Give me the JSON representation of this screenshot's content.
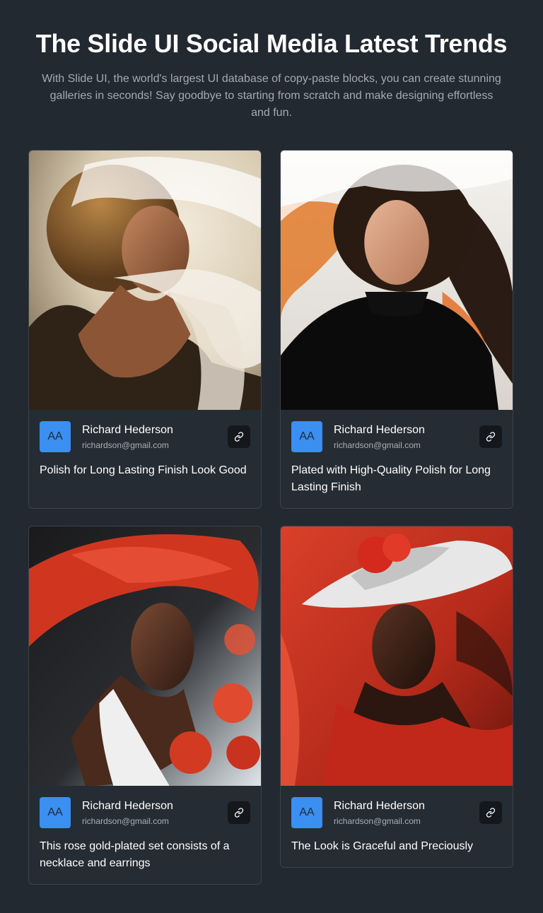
{
  "header": {
    "title": "The Slide UI Social Media Latest Trends",
    "subtitle": "With Slide UI, the world's largest UI database of copy-paste blocks, you can create stunning galleries in seconds! Say goodbye to starting from scratch and make designing effortless and fun."
  },
  "cards": [
    {
      "avatar_initials": "AA",
      "author_name": "Richard Hederson",
      "author_email": "richardson@gmail.com",
      "description": "Polish for Long Lasting Finish Look Good"
    },
    {
      "avatar_initials": "AA",
      "author_name": "Richard Hederson",
      "author_email": "richardson@gmail.com",
      "description": "Plated with High-Quality Polish for Long Lasting Finish"
    },
    {
      "avatar_initials": "AA",
      "author_name": "Richard Hederson",
      "author_email": "richardson@gmail.com",
      "description": "This rose gold-plated set consists of a necklace and earrings"
    },
    {
      "avatar_initials": "AA",
      "author_name": "Richard Hederson",
      "author_email": "richardson@gmail.com",
      "description": "The Look is Graceful and Preciously"
    }
  ],
  "icons": {
    "link": "link-icon"
  },
  "colors": {
    "background": "#232930",
    "card": "#262c33",
    "avatar": "#3b8ff0",
    "link_button": "#14171c"
  }
}
